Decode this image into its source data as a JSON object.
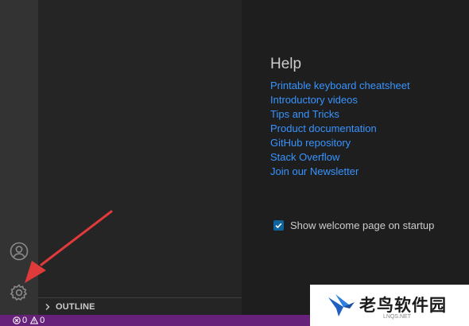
{
  "activity_bar": {
    "icons": [
      "account-icon",
      "gear-icon"
    ]
  },
  "sidebar": {
    "outline_label": "OUTLINE"
  },
  "welcome": {
    "help_title": "Help",
    "links": [
      "Printable keyboard cheatsheet",
      "Introductory videos",
      "Tips and Tricks",
      "Product documentation",
      "GitHub repository",
      "Stack Overflow",
      "Join our Newsletter"
    ],
    "show_on_startup": {
      "label": "Show welcome page on startup",
      "checked": true
    }
  },
  "status_bar": {
    "errors": "0",
    "warnings": "0"
  },
  "annotation": {
    "arrow_color": "#e03a3a"
  },
  "watermark": {
    "text": "老鸟软件园",
    "sub": "LNQS.NET"
  },
  "colors": {
    "activity_bar": "#333333",
    "sidebar": "#252526",
    "editor": "#1e1e1e",
    "link": "#3794ff",
    "status_bar": "#68217a"
  }
}
